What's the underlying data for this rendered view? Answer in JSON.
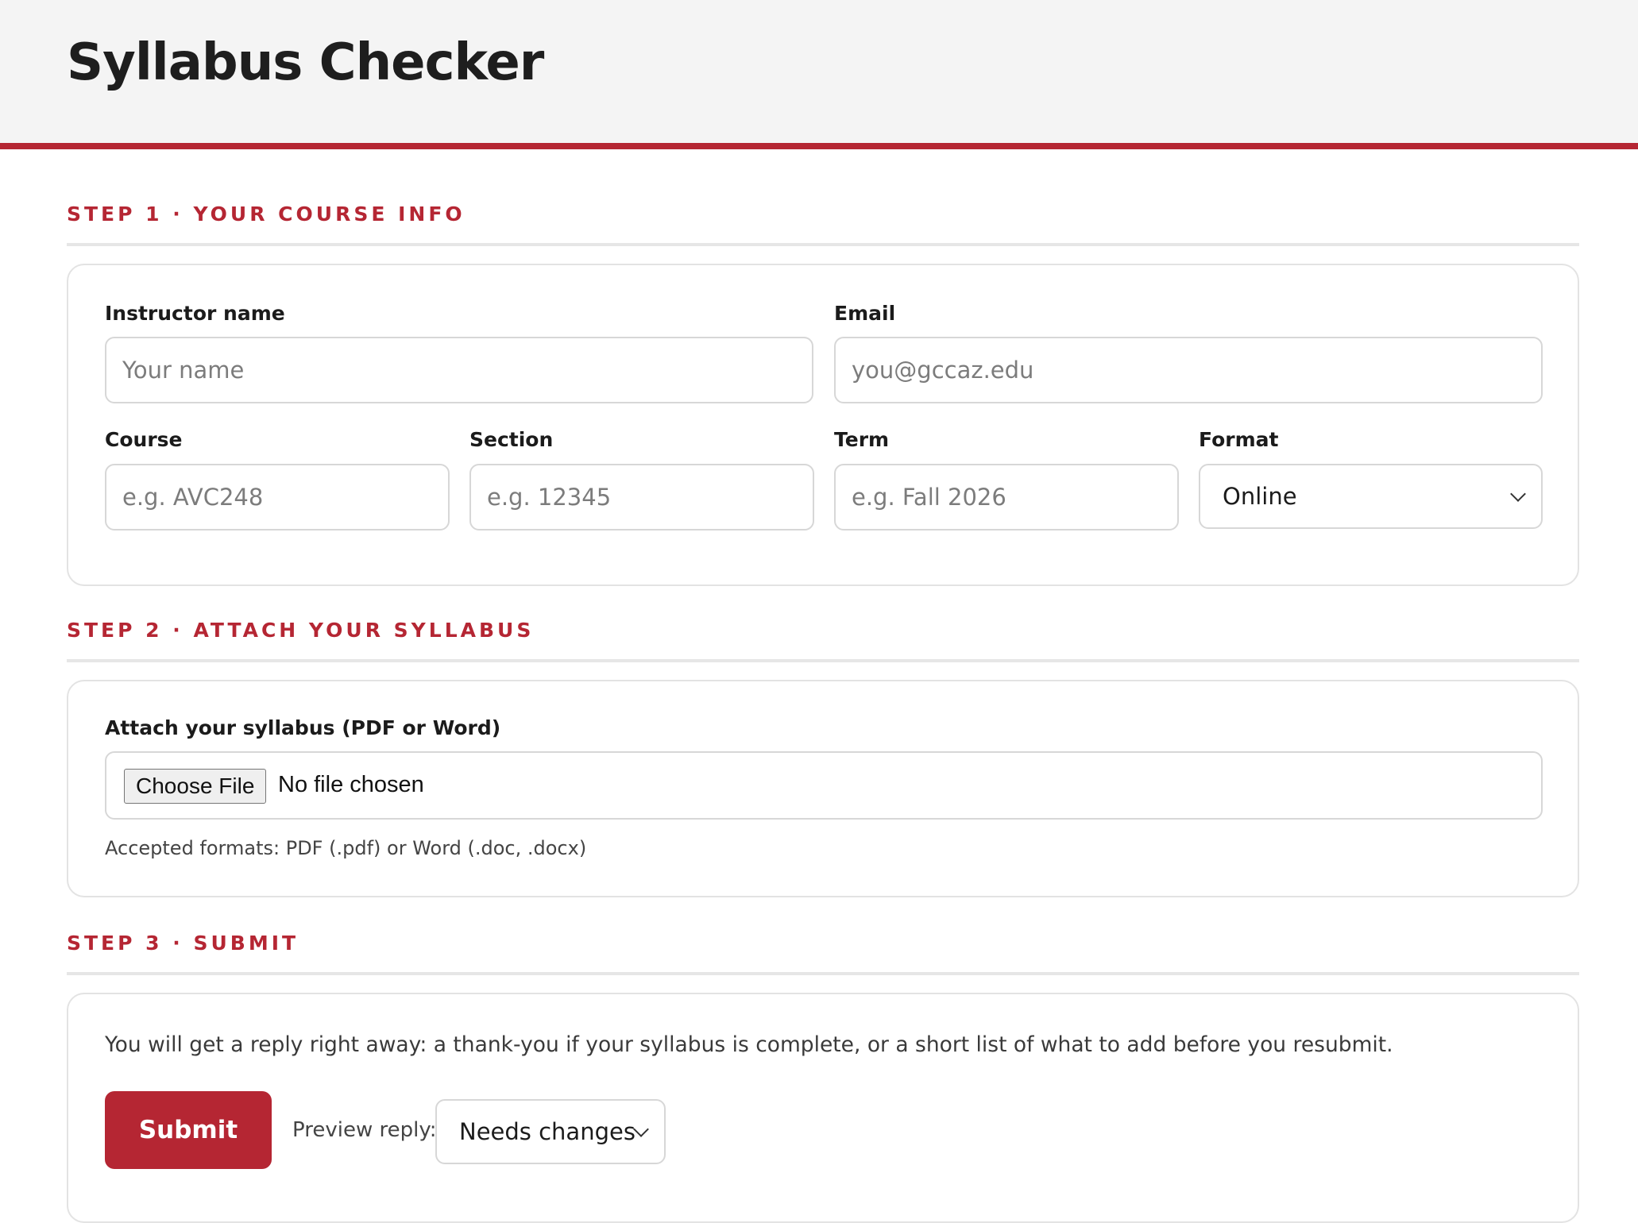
{
  "header": {
    "title": "Syllabus Checker"
  },
  "step1": {
    "title": "STEP 1 · YOUR COURSE INFO",
    "instructor": {
      "label": "Instructor name",
      "placeholder": "Your name"
    },
    "email": {
      "label": "Email",
      "placeholder": "you@gccaz.edu"
    },
    "course": {
      "label": "Course",
      "placeholder": "e.g. AVC248"
    },
    "section": {
      "label": "Section",
      "placeholder": "e.g. 12345"
    },
    "term": {
      "label": "Term",
      "placeholder": "e.g. Fall 2026"
    },
    "format": {
      "label": "Format",
      "selected": "Online"
    }
  },
  "step2": {
    "title": "STEP 2 · ATTACH YOUR SYLLABUS",
    "attach_label": "Attach your syllabus (PDF or Word)",
    "choose_file": "Choose File",
    "file_status": "No file chosen",
    "hint": "Accepted formats: PDF (.pdf) or Word (.doc, .docx)"
  },
  "step3": {
    "title": "STEP 3 · SUBMIT",
    "description": "You will get a reply right away: a thank-you if your syllabus is complete, or a short list of what to add before you resubmit.",
    "submit_label": "Submit",
    "preview_label": "Preview reply:",
    "preview_selected": "Needs changes"
  },
  "colors": {
    "accent": "#b52633",
    "header_bg": "#f4f4f4",
    "border": "#d7d7d7"
  }
}
